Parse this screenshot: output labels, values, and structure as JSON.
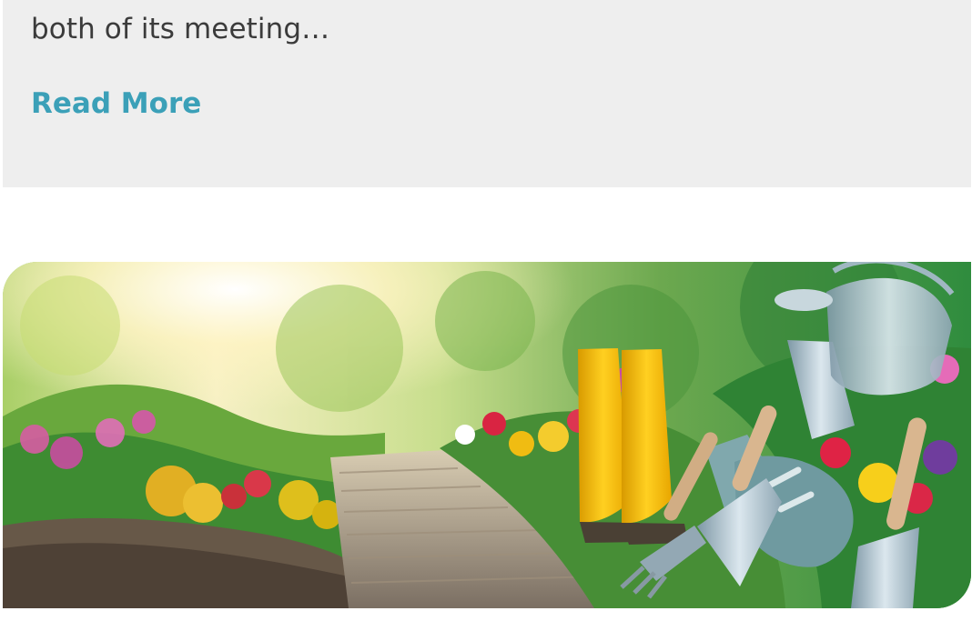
{
  "article_top": {
    "excerpt_end": "both of its meeting…",
    "read_more_label": "Read More"
  },
  "article_image": {
    "subject": "garden path with flowers, yellow boots, watering can, gloves and tools"
  },
  "colors": {
    "card_background": "#eeeeee",
    "body_text": "#3b3b3b",
    "link": "#3ba0b8"
  }
}
